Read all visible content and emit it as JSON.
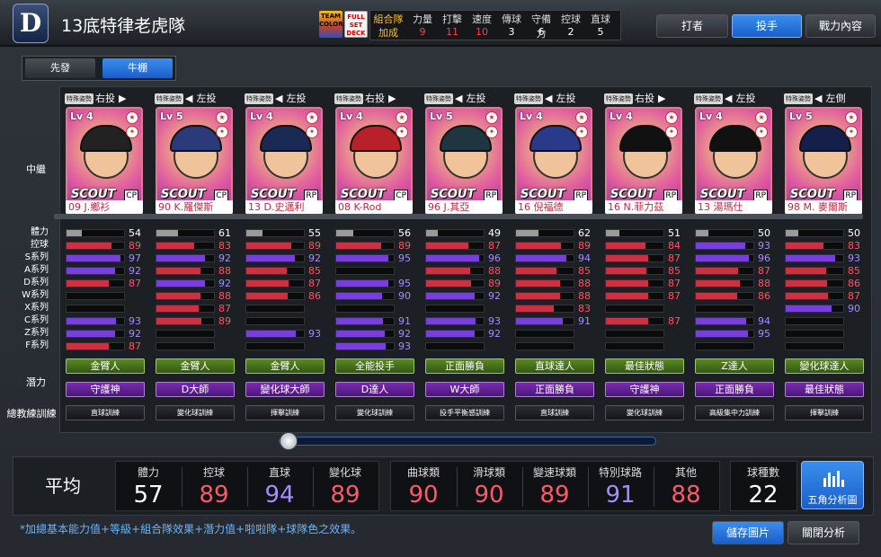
{
  "header": {
    "logo": "D",
    "team_name": "13底特律老虎隊",
    "badge_team": "TEAM COLOR",
    "badge_full": "FULL SET DECK",
    "combo": {
      "label1": "組合隊",
      "label2": "加成"
    },
    "combo_stats": [
      {
        "label": "力量",
        "value": "9"
      },
      {
        "label": "打擊",
        "value": "11"
      },
      {
        "label": "速度",
        "value": "10"
      },
      {
        "label": "傳球",
        "value": "3"
      },
      {
        "label": "守備力",
        "value": "6"
      },
      {
        "label": "控球",
        "value": "2"
      },
      {
        "label": "直球",
        "value": "5"
      }
    ],
    "tabs": [
      "打者",
      "投手",
      "戰力內容"
    ],
    "active_tab": "投手"
  },
  "sub_tabs": [
    "先發",
    "牛棚"
  ],
  "row_labels": {
    "role": "中繼",
    "potential": "潛力",
    "coach": "總教練訓練"
  },
  "stat_labels": [
    "體力",
    "控球",
    "S系列",
    "A系列",
    "D系列",
    "W系列",
    "X系列",
    "C系列",
    "Z系列",
    "F系列"
  ],
  "colors": {
    "stamina": "#9a9a9a",
    "red": "#c9323f",
    "purple": "#7b3fd9",
    "val_red": "#ff5560",
    "val_purple": "#a58cff",
    "val_white": "#ffffff"
  },
  "players": [
    {
      "special": "特殊姿勢",
      "hand": "右投",
      "arrow": "▶",
      "lv": "Lv 4",
      "name": "09 J.鄉衫",
      "pos": "CP",
      "stats": [
        54,
        89,
        97,
        92,
        87,
        null,
        null,
        93,
        92,
        87
      ],
      "pot1": "金臂人",
      "pot2": "守護神",
      "coach": "直球訓練",
      "cap": "#222"
    },
    {
      "special": "特殊姿勢",
      "hand": "左投",
      "arrow": "◀",
      "lv": "Lv 5",
      "name": "90 K.羅傑斯",
      "pos": "CP",
      "stats": [
        61,
        83,
        92,
        88,
        92,
        88,
        87,
        89,
        null,
        null
      ],
      "pot1": "金臂人",
      "pot2": "D大師",
      "coach": "變化球訓練",
      "cap": "#2a3a7a"
    },
    {
      "special": "特殊姿勢",
      "hand": "左投",
      "arrow": "◀",
      "lv": "Lv 4",
      "name": "13 D.史邁利",
      "pos": "RP",
      "stats": [
        55,
        89,
        92,
        85,
        87,
        86,
        null,
        null,
        93,
        null
      ],
      "pot1": "金臂人",
      "pot2": "變化球大師",
      "coach": "揮擊訓練",
      "cap": "#1a2a55"
    },
    {
      "special": "特殊姿勢",
      "hand": "右投",
      "arrow": "▶",
      "lv": "Lv 4",
      "name": "08 K-Rod",
      "pos": "CP",
      "stats": [
        56,
        89,
        95,
        null,
        95,
        90,
        null,
        91,
        92,
        93
      ],
      "pot1": "全能投手",
      "pot2": "D達人",
      "coach": "變化球訓練",
      "cap": "#b8202a"
    },
    {
      "special": "特殊姿勢",
      "hand": "左投",
      "arrow": "◀",
      "lv": "Lv 5",
      "name": "96 J.其亞",
      "pos": "RP",
      "stats": [
        49,
        87,
        96,
        88,
        89,
        92,
        null,
        93,
        92,
        null
      ],
      "pot1": "正面勝負",
      "pot2": "W大師",
      "coach": "投手平衡感訓練",
      "cap": "#1f3540"
    },
    {
      "special": "特殊姿勢",
      "hand": "左投",
      "arrow": "◀",
      "lv": "Lv 4",
      "name": "16 倪福德",
      "pos": "RP",
      "stats": [
        62,
        89,
        94,
        85,
        88,
        88,
        83,
        91,
        null,
        null
      ],
      "pot1": "直球達人",
      "pot2": "正面勝負",
      "coach": "直球訓練",
      "cap": "#2a3a8a"
    },
    {
      "special": "特殊姿勢",
      "hand": "右投",
      "arrow": "▶",
      "lv": "Lv 4",
      "name": "16 N.菲力茲",
      "pos": "RP",
      "stats": [
        51,
        84,
        87,
        85,
        87,
        87,
        null,
        87,
        null,
        null
      ],
      "pot1": "最佳狀態",
      "pot2": "守護神",
      "coach": "變化球訓練",
      "cap": "#111"
    },
    {
      "special": "特殊姿勢",
      "hand": "左投",
      "arrow": "◀",
      "lv": "Lv 4",
      "name": "13 湯瑪仕",
      "pos": "RP",
      "stats": [
        50,
        93,
        96,
        87,
        88,
        86,
        null,
        94,
        95,
        null
      ],
      "pot1": "Z達人",
      "pot2": "正面勝負",
      "coach": "高級集中力訓練",
      "cap": "#111"
    },
    {
      "special": "特殊姿勢",
      "hand": "左側",
      "arrow": "◀",
      "lv": "Lv 5",
      "name": "98 M. 麥爾斯",
      "pos": "RP",
      "stats": [
        50,
        83,
        93,
        85,
        86,
        87,
        90,
        null,
        null,
        null
      ],
      "pot1": "變化球達人",
      "pot2": "最佳狀態",
      "coach": "揮擊訓練",
      "cap": "#14204a"
    }
  ],
  "average": {
    "title": "平均",
    "items": [
      {
        "label": "體力",
        "value": "57",
        "color": "#ffffff"
      },
      {
        "label": "控球",
        "value": "89",
        "color": "#ff5a6a"
      },
      {
        "label": "直球",
        "value": "94",
        "color": "#a58cff"
      },
      {
        "label": "變化球",
        "value": "89",
        "color": "#ff5a6a"
      },
      {
        "label": "曲球類",
        "value": "90",
        "color": "#ff5a6a"
      },
      {
        "label": "滑球類",
        "value": "90",
        "color": "#ff5a6a"
      },
      {
        "label": "變速球類",
        "value": "89",
        "color": "#ff5a6a"
      },
      {
        "label": "特別球路",
        "value": "91",
        "color": "#a58cff"
      },
      {
        "label": "其他",
        "value": "88",
        "color": "#ff5a6a"
      },
      {
        "label": "球種數",
        "value": "22",
        "color": "#ffffff"
      }
    ],
    "analysis_button": "五角分析圖"
  },
  "footnote": "*加總基本能力值+等級+組合隊效果+潛力值+啦啦隊+球隊色之效果。",
  "footer_buttons": [
    "儲存圖片",
    "關閉分析"
  ]
}
